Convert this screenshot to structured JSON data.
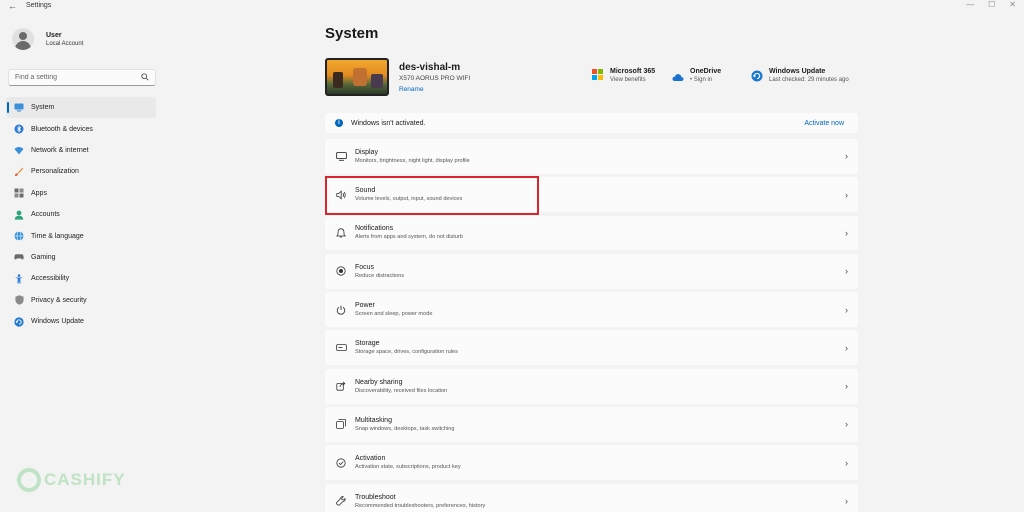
{
  "window": {
    "title": "Settings",
    "back_glyph": "←",
    "min_glyph": "—",
    "max_glyph": "☐",
    "close_glyph": "✕"
  },
  "user": {
    "name": "User",
    "account_type": "Local Account"
  },
  "search": {
    "placeholder": "Find a setting"
  },
  "sidebar": {
    "items": [
      {
        "label": "System",
        "icon": "monitor-icon",
        "active": true
      },
      {
        "label": "Bluetooth & devices",
        "icon": "bluetooth-icon"
      },
      {
        "label": "Network & internet",
        "icon": "wifi-icon"
      },
      {
        "label": "Personalization",
        "icon": "brush-icon"
      },
      {
        "label": "Apps",
        "icon": "apps-icon"
      },
      {
        "label": "Accounts",
        "icon": "person-icon"
      },
      {
        "label": "Time & language",
        "icon": "globe-clock-icon"
      },
      {
        "label": "Gaming",
        "icon": "gamepad-icon"
      },
      {
        "label": "Accessibility",
        "icon": "accessibility-icon"
      },
      {
        "label": "Privacy & security",
        "icon": "shield-icon"
      },
      {
        "label": "Windows Update",
        "icon": "update-icon"
      }
    ]
  },
  "main": {
    "title": "System",
    "device": {
      "name": "des-vishal-m",
      "model": "X570 AORUS PRO WIFI",
      "rename": "Rename"
    },
    "services": [
      {
        "title": "Microsoft 365",
        "subtitle": "View benefits",
        "icon": "microsoft-logo-icon"
      },
      {
        "title": "OneDrive",
        "subtitle": "• Sign in",
        "icon": "cloud-icon"
      },
      {
        "title": "Windows Update",
        "subtitle": "Last checked: 29 minutes ago",
        "icon": "update-icon"
      }
    ],
    "activation_banner": {
      "text": "Windows isn't activated.",
      "link": "Activate now"
    },
    "settings": [
      {
        "title": "Display",
        "subtitle": "Monitors, brightness, night light, display profile",
        "icon": "display-icon"
      },
      {
        "title": "Sound",
        "subtitle": "Volume levels, output, input, sound devices",
        "icon": "speaker-icon"
      },
      {
        "title": "Notifications",
        "subtitle": "Alerts from apps and system, do not disturb",
        "icon": "bell-icon"
      },
      {
        "title": "Focus",
        "subtitle": "Reduce distractions",
        "icon": "focus-icon"
      },
      {
        "title": "Power",
        "subtitle": "Screen and sleep, power mode",
        "icon": "power-icon"
      },
      {
        "title": "Storage",
        "subtitle": "Storage space, drives, configuration rules",
        "icon": "storage-icon"
      },
      {
        "title": "Nearby sharing",
        "subtitle": "Discoverability, received files location",
        "icon": "share-icon"
      },
      {
        "title": "Multitasking",
        "subtitle": "Snap windows, desktops, task switching",
        "icon": "multitasking-icon"
      },
      {
        "title": "Activation",
        "subtitle": "Activation state, subscriptions, product key",
        "icon": "check-circle-icon"
      },
      {
        "title": "Troubleshoot",
        "subtitle": "Recommended troubleshooters, preferences, history",
        "icon": "wrench-icon"
      }
    ]
  },
  "watermark": {
    "text": "CASHIFY"
  },
  "colors": {
    "accent": "#0067c0",
    "highlight_box": "#d9262c",
    "watermark": "#bfe3c4"
  }
}
